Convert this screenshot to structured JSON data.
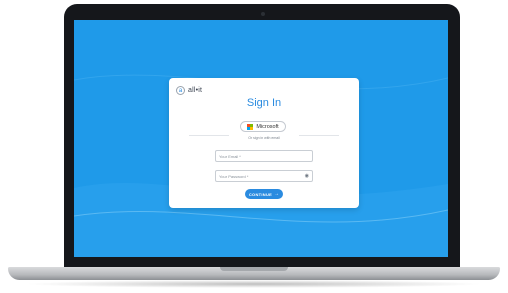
{
  "brand": {
    "logo_text": "all•it"
  },
  "login": {
    "title": "Sign In",
    "microsoft_label": "Microsoft",
    "divider_text": "Or sign in with email",
    "email_placeholder": "Your Email *",
    "password_placeholder": "Your Password *",
    "continue_label": "CONTINUE",
    "continue_arrow": "→"
  },
  "icons": {
    "logo": "a-circle-logo",
    "microsoft": "microsoft-logo-icon",
    "password_reveal": "eye-icon",
    "continue": "arrow-right-icon"
  },
  "colors": {
    "screen_bg": "#1f9ae9",
    "accent": "#2a8be0",
    "ms_red": "#f25022",
    "ms_green": "#7fba00",
    "ms_blue": "#00a4ef",
    "ms_yellow": "#ffb900"
  }
}
